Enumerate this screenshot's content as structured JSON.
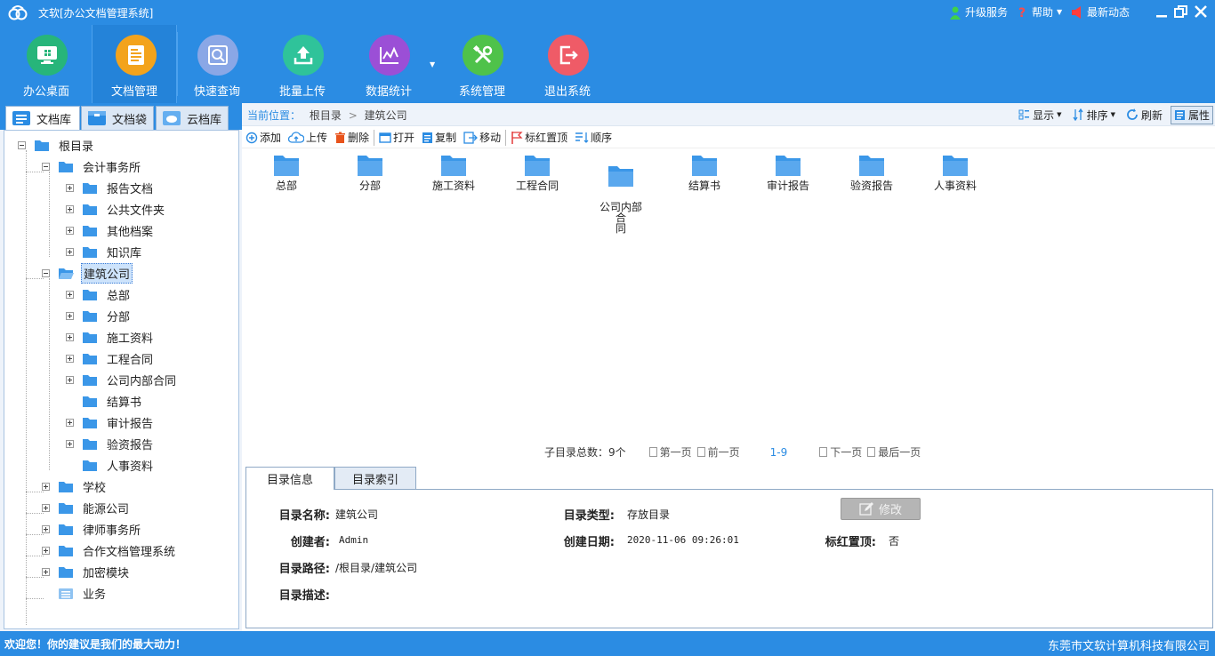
{
  "window": {
    "title": "文软[办公文档管理系统]",
    "links": {
      "upgrade": "升级服务",
      "help": "帮助",
      "news": "最新动态"
    }
  },
  "toolbar": {
    "items": [
      {
        "label": "办公桌面",
        "color": "#27b57a",
        "icon": "desktop-icon"
      },
      {
        "label": "文档管理",
        "color": "#f3a31c",
        "icon": "document-icon"
      },
      {
        "label": "快速查询",
        "color": "#8aa7e6",
        "icon": "search-icon"
      },
      {
        "label": "批量上传",
        "color": "#2fc39a",
        "icon": "upload-icon"
      },
      {
        "label": "数据统计",
        "color": "#9b4fd6",
        "icon": "chart-icon"
      },
      {
        "label": "系统管理",
        "color": "#4fc24a",
        "icon": "tools-icon"
      },
      {
        "label": "退出系统",
        "color": "#ef5b67",
        "icon": "exit-icon"
      }
    ]
  },
  "left": {
    "tabs": [
      "文档库",
      "文档袋",
      "云档库"
    ],
    "tree": {
      "root": "根目录",
      "accounting": "会计事务所",
      "accounting_children": [
        "报告文档",
        "公共文件夹",
        "其他档案",
        "知识库"
      ],
      "construction": "建筑公司",
      "construction_children": [
        "总部",
        "分部",
        "施工资料",
        "工程合同",
        "公司内部合同",
        "结算书",
        "审计报告",
        "验资报告",
        "人事资料"
      ],
      "others": [
        "学校",
        "能源公司",
        "律师事务所",
        "合作文档管理系统",
        "加密模块",
        "业务"
      ]
    }
  },
  "main": {
    "breadcrumb": {
      "prefix": "当前位置：",
      "root": "根目录",
      "sep": ">",
      "current": "建筑公司"
    },
    "view": {
      "display": "显示",
      "sort": "排序",
      "refresh": "刷新",
      "props": "属性"
    },
    "actions": {
      "add": "添加",
      "upload": "上传",
      "delete": "删除",
      "open": "打开",
      "copy": "复制",
      "move": "移动",
      "flag_top": "标红置顶",
      "order": "顺序"
    },
    "folders": [
      "总部",
      "分部",
      "施工资料",
      "工程合同",
      "公司内部合\n同",
      "结算书",
      "审计报告",
      "验资报告",
      "人事资料"
    ],
    "pager": {
      "total": "子目录总数：9个",
      "first": "第一页",
      "prev": "前一页",
      "current": "1-9",
      "next": "下一页",
      "last": "最后一页"
    }
  },
  "info": {
    "tabs": [
      "目录信息",
      "目录索引"
    ],
    "name_label": "目录名称:",
    "name": "建筑公司",
    "type_label": "目录类型:",
    "type": "存放目录",
    "creator_label": "创建者:",
    "creator": "Admin",
    "date_label": "创建日期:",
    "date": "2020-11-06 09:26:01",
    "flag_label": "标红置顶:",
    "flag": "否",
    "path_label": "目录路径:",
    "path": "/根目录/建筑公司",
    "desc_label": "目录描述:",
    "edit_button": "修改"
  },
  "status": {
    "left": "欢迎您！你的建议是我们的最大动力！",
    "right": "东莞市文软计算机科技有限公司"
  },
  "colors": {
    "primary": "#2b8ce3",
    "folder": "#3b97e8"
  }
}
